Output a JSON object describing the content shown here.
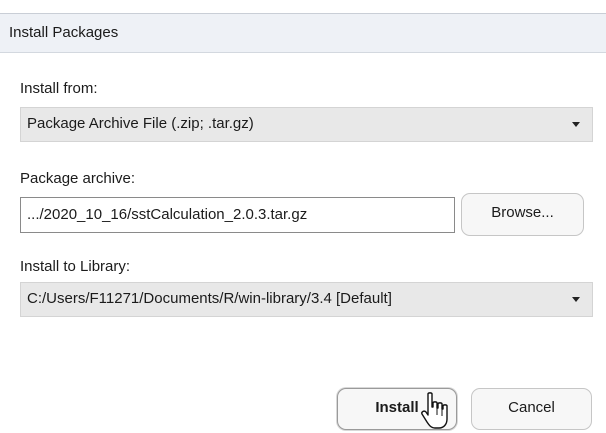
{
  "dialog": {
    "title": "Install Packages"
  },
  "install_from": {
    "label": "Install from:",
    "selected": "Package Archive File (.zip; .tar.gz)"
  },
  "package_archive": {
    "label": "Package archive:",
    "value": ".../2020_10_16/sstCalculation_2.0.3.tar.gz",
    "browse_label": "Browse..."
  },
  "install_to_library": {
    "label": "Install to Library:",
    "selected": "C:/Users/F11271/Documents/R/win-library/3.4 [Default]"
  },
  "actions": {
    "install_label": "Install",
    "cancel_label": "Cancel"
  },
  "icons": {
    "dropdown": "chevron-down-icon",
    "cursor": "hand-pointer-icon"
  }
}
